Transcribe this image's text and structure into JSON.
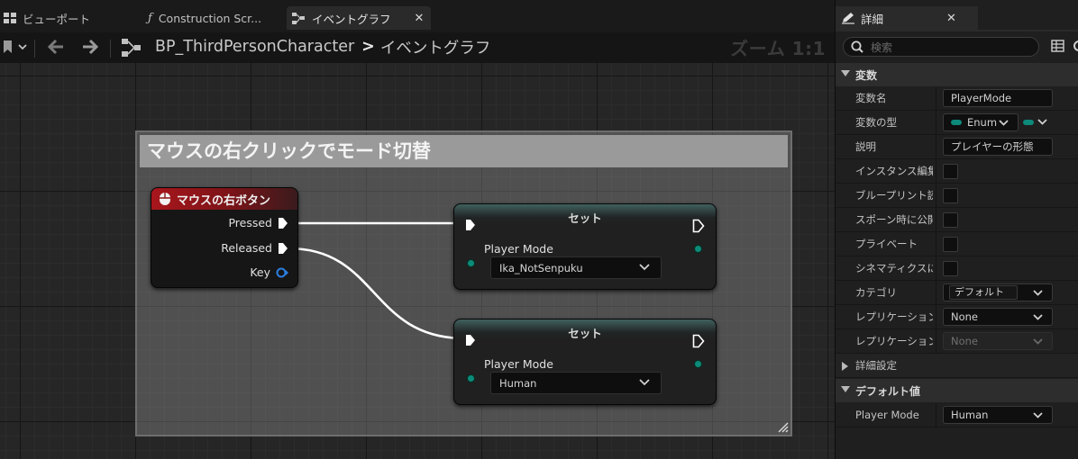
{
  "tabs": [
    {
      "label": "ビューポート",
      "icon": "viewport-grid-icon"
    },
    {
      "label": "Construction Scr...",
      "icon": "function-icon"
    },
    {
      "label": "イベントグラフ",
      "icon": "event-graph-icon",
      "active": true
    }
  ],
  "toolbar": {
    "breadcrumb_root": "BP_ThirdPersonCharacter",
    "breadcrumb_sep": ">",
    "breadcrumb_current": "イベントグラフ",
    "zoom": "ズーム 1:1"
  },
  "graph": {
    "comment_title": "マウスの右クリックでモード切替",
    "event_node": {
      "title": "マウスの右ボタン",
      "pins": [
        "Pressed",
        "Released",
        "Key"
      ]
    },
    "set_nodes": [
      {
        "title": "セット",
        "label": "Player Mode",
        "value": "Ika_NotSenpuku"
      },
      {
        "title": "セット",
        "label": "Player Mode",
        "value": "Human"
      }
    ]
  },
  "details": {
    "tab_label": "詳細",
    "search_placeholder": "検索",
    "section_variable": "変数",
    "props": {
      "var_name_label": "変数名",
      "var_name_value": "PlayerMode",
      "var_type_label": "変数の型",
      "var_type_value": "Enum",
      "desc_label": "説明",
      "desc_value": "プレイヤーの形態",
      "instance_editable": "インスタンス編集可能",
      "bp_readonly": "ブループリント読み取り専用",
      "expose_spawn": "スポーン時に公開",
      "private": "プライベート",
      "cinematics": "シネマティクスに公開",
      "category_label": "カテゴリ",
      "category_value": "デフォルト",
      "replication_label": "レプリケーション",
      "replication_value": "None",
      "replication_cond_label": "レプリケーション条件",
      "replication_cond_value": "None"
    },
    "section_advanced": "詳細設定",
    "section_default": "デフォルト値",
    "default_label": "Player Mode",
    "default_value": "Human"
  },
  "colors": {
    "event_header": "#a8161c",
    "enum_pin": "#0d8a7a",
    "exec_wire": "#ffffff"
  }
}
